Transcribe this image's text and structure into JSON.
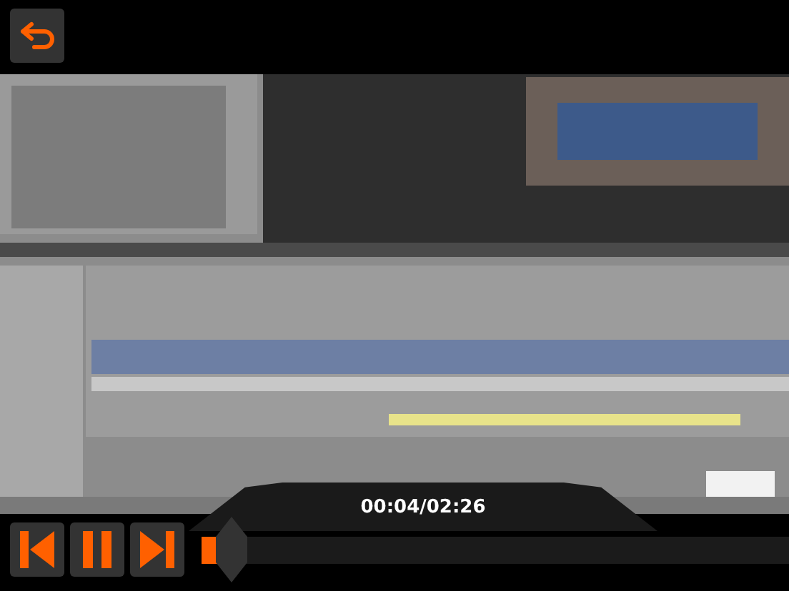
{
  "time": "00:04/02:26",
  "controls": {
    "playing": true
  },
  "progress": {
    "level": 0.03
  }
}
